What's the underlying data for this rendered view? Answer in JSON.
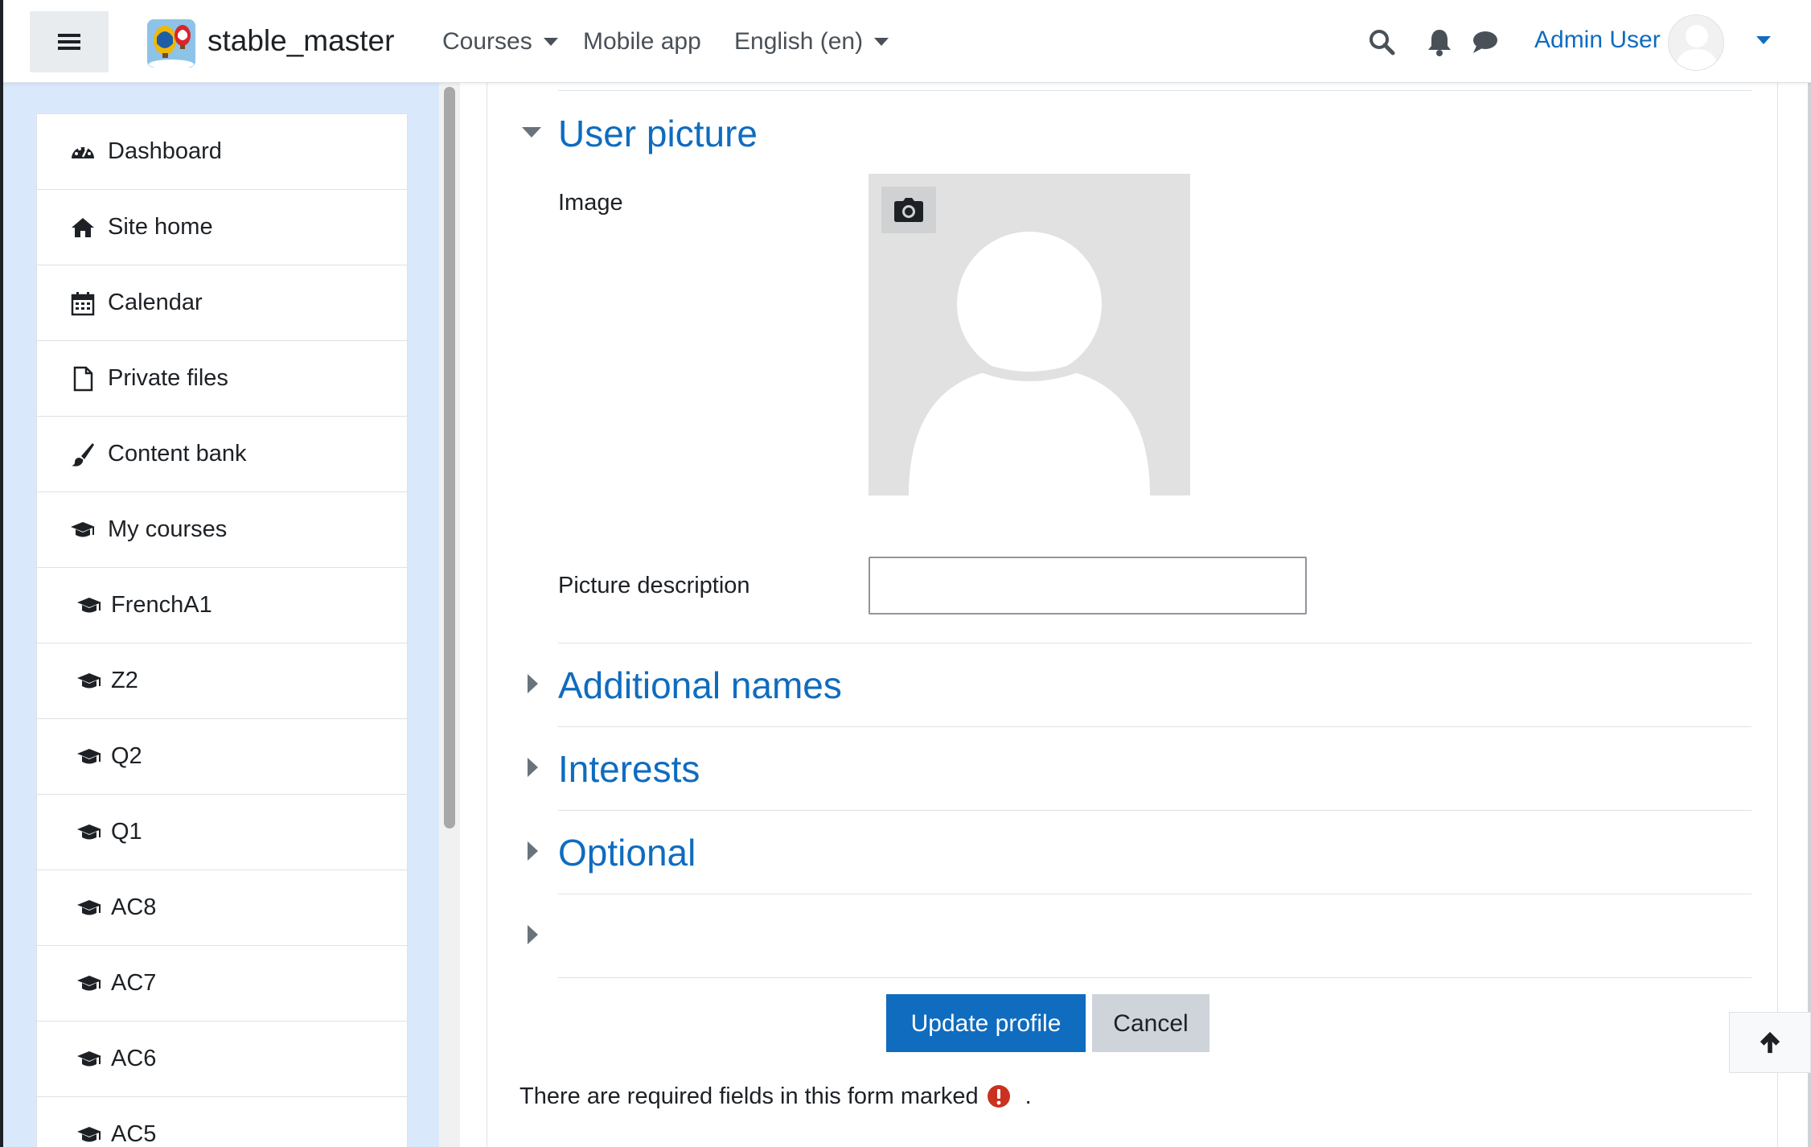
{
  "navbar": {
    "brand": "stable_master",
    "courses_label": "Courses",
    "mobile_app_label": "Mobile app",
    "language_label": "English (en)",
    "user_name": "Admin User",
    "icons": [
      "menu-icon",
      "search-icon",
      "bell-icon",
      "chat-icon",
      "chevron-down-icon"
    ]
  },
  "drawer": {
    "items": [
      {
        "label": "Dashboard",
        "icon": "dashboard-icon"
      },
      {
        "label": "Site home",
        "icon": "home-icon"
      },
      {
        "label": "Calendar",
        "icon": "calendar-icon"
      },
      {
        "label": "Private files",
        "icon": "file-icon"
      },
      {
        "label": "Content bank",
        "icon": "paintbrush-icon"
      },
      {
        "label": "My courses",
        "icon": "graduation-cap-icon"
      }
    ],
    "courses": [
      {
        "label": "FrenchA1",
        "icon": "graduation-cap-icon"
      },
      {
        "label": "Z2",
        "icon": "graduation-cap-icon"
      },
      {
        "label": "Q2",
        "icon": "graduation-cap-icon"
      },
      {
        "label": "Q1",
        "icon": "graduation-cap-icon"
      },
      {
        "label": "AC8",
        "icon": "graduation-cap-icon"
      },
      {
        "label": "AC7",
        "icon": "graduation-cap-icon"
      },
      {
        "label": "AC6",
        "icon": "graduation-cap-icon"
      },
      {
        "label": "AC5",
        "icon": "graduation-cap-icon"
      }
    ]
  },
  "form": {
    "user_picture": {
      "title": "User picture",
      "image_label": "Image",
      "description_label": "Picture description",
      "description_value": "",
      "camera_icon": "camera-icon"
    },
    "sections": [
      {
        "title": "Additional names"
      },
      {
        "title": "Interests"
      },
      {
        "title": "Optional"
      },
      {
        "title": ""
      }
    ],
    "buttons": {
      "update": "Update profile",
      "cancel": "Cancel"
    },
    "required_note_prefix": "There are required fields in this form marked",
    "required_note_suffix": ".",
    "required_icon": "exclamation-circle-icon"
  },
  "back_to_top_icon": "arrow-up-icon",
  "colors": {
    "primary": "#0f6cbf",
    "drawer_bg": "#d9e8fb",
    "required": "#ca3120"
  }
}
